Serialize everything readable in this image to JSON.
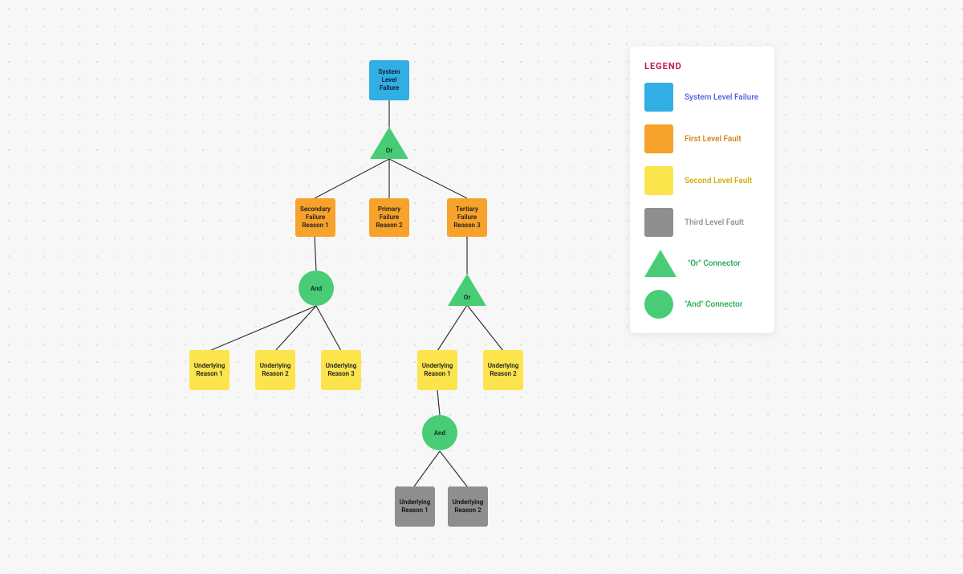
{
  "diagram": {
    "nodes": {
      "root": "System Level Failure",
      "l1": {
        "a": "Secondary Failure Reason 1",
        "b": "Primary Failure Reason 2",
        "c": "Tertiary Failure Reason 3"
      },
      "l2_left": {
        "a": "Underlying Reason 1",
        "b": "Underlying Reason 2",
        "c": "Underlying Reason 3"
      },
      "l2_right": {
        "a": "Underlying Reason 1",
        "b": "Underlying Reason 2"
      },
      "l3": {
        "a": "Underlying Reason 1",
        "b": "Underlying Reason 2"
      }
    },
    "gates": {
      "g_or_top": "Or",
      "g_and_left": "And",
      "g_or_right": "Or",
      "g_and_bottom": "And"
    }
  },
  "legend": {
    "title": "LEGEND",
    "items": {
      "system": "System Level Failure",
      "first": "First Level Fault",
      "second": "Second Level Fault",
      "third": "Third Level Fault",
      "or": "\"Or\" Connector",
      "and": "\"And\" Connector"
    }
  },
  "colors": {
    "system": "#31aee3",
    "first": "#f6a22b",
    "second": "#fce44d",
    "third": "#8e8e8e",
    "gate": "#48cd76"
  }
}
